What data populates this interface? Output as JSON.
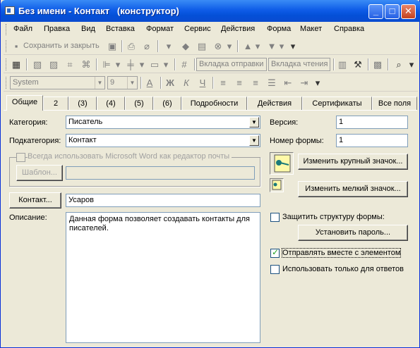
{
  "window": {
    "title": "Без имени - Контакт   (конструктор)"
  },
  "menubar": {
    "items": [
      "Файл",
      "Правка",
      "Вид",
      "Вставка",
      "Формат",
      "Сервис",
      "Действия",
      "Форма",
      "Макет",
      "Справка"
    ]
  },
  "toolbar1": {
    "save_close": "Сохранить и закрыть"
  },
  "toolbar2": {
    "font": "System",
    "size": "9",
    "sender_field": "Вкладка отправки",
    "reader_field": "Вкладка чтения"
  },
  "tabs": [
    "Общие",
    "2",
    "(3)",
    "(4)",
    "(5)",
    "(6)",
    "Подробности",
    "Действия",
    "Сертификаты",
    "Все поля"
  ],
  "form": {
    "category_label": "Категория:",
    "category_value": "Писатель",
    "subcategory_label": "Подкатегория:",
    "subcategory_value": "Контакт",
    "word_editor_label": "Всегда использовать Microsoft Word как редактор почты",
    "template_button": "Шаблон...",
    "contact_button": "Контакт...",
    "contact_value": "Усаров",
    "description_label": "Описание:",
    "description_value": "Данная форма позволяет создавать контакты для писателей.",
    "version_label": "Версия:",
    "version_value": "1",
    "form_number_label": "Номер формы:",
    "form_number_value": "1",
    "change_large_icon": "Изменить крупный значок...",
    "change_small_icon": "Изменить мелкий значок...",
    "protect_label": "Защитить структуру формы:",
    "set_password": "Установить пароль...",
    "send_with_item_label": "Отправлять вместе с элементом",
    "send_with_item_checked": true,
    "reply_only_label": "Использовать только для ответов",
    "reply_only_checked": false
  }
}
